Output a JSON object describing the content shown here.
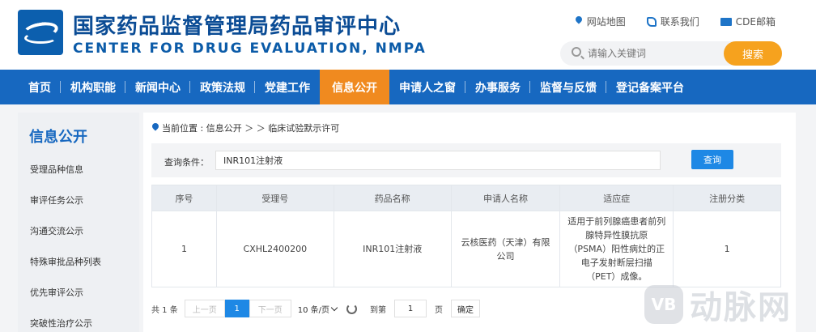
{
  "header": {
    "title_cn": "国家药品监督管理局药品审评中心",
    "title_en": "CENTER FOR DRUG EVALUATION, NMPA",
    "links": [
      "网站地图",
      "联系我们",
      "CDE邮箱"
    ],
    "search_placeholder": "请输入关键词",
    "search_button": "搜索"
  },
  "nav": {
    "items": [
      "首页",
      "机构职能",
      "新闻中心",
      "政策法规",
      "党建工作",
      "信息公开",
      "申请人之窗",
      "办事服务",
      "监督与反馈",
      "登记备案平台"
    ],
    "active": "信息公开"
  },
  "sidebar": {
    "title": "信息公开",
    "items": [
      "受理品种信息",
      "审评任务公示",
      "沟通交流公示",
      "特殊审批品种列表",
      "优先审评公示",
      "突破性治疗公示"
    ]
  },
  "breadcrumb": "当前位置 : 信息公开 ＞ ＞ 临床试验默示许可",
  "query": {
    "label": "查询条件：",
    "value": "INR101注射液",
    "button": "查询"
  },
  "table": {
    "headers": [
      "序号",
      "受理号",
      "药品名称",
      "申请人名称",
      "适应症",
      "注册分类"
    ],
    "rows": [
      [
        "1",
        "CXHL2400200",
        "INR101注射液",
        "云核医药（天津）有限公司",
        "适用于前列腺癌患者前列腺特异性膜抗原（PSMA）阳性病灶的正电子发射断层扫描（PET）成像。",
        "1"
      ]
    ]
  },
  "pager": {
    "total": "共 1 条",
    "prev": "上一页",
    "current": "1",
    "next": "下一页",
    "page_size": "10 条/页",
    "goto_label": "到第",
    "goto_value": "1",
    "page_unit": "页",
    "confirm": "确定"
  },
  "watermark": {
    "logo": "VB",
    "text": "动脉网"
  },
  "colors": {
    "nav_blue": "#1768c0",
    "active_orange": "#f08a1f",
    "search_orange": "#f6a21e",
    "button_blue": "#1e88e5"
  }
}
